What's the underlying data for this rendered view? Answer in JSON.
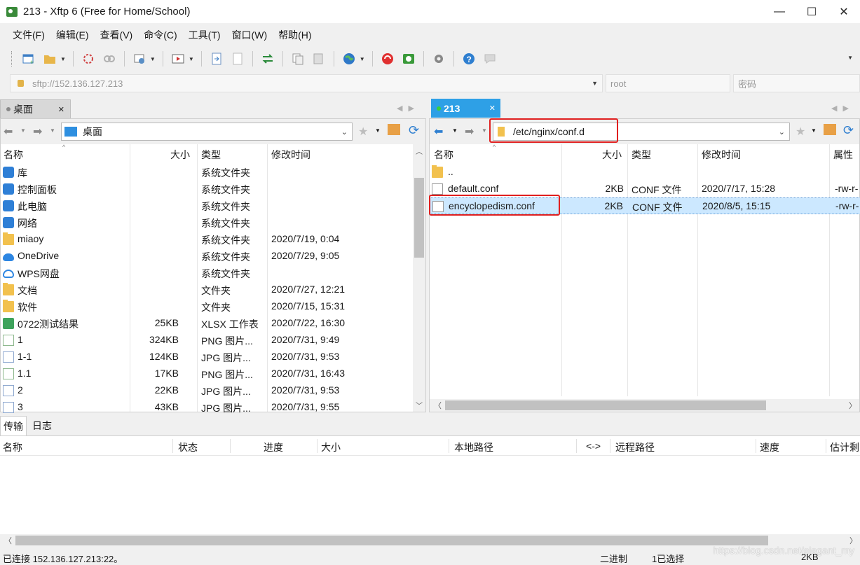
{
  "window": {
    "title": "213 - Xftp 6 (Free for Home/School)",
    "minimize": "—",
    "maximize": "☐",
    "close": "✕"
  },
  "menu": [
    "文件(F)",
    "编辑(E)",
    "查看(V)",
    "命令(C)",
    "工具(T)",
    "窗口(W)",
    "帮助(H)"
  ],
  "address": {
    "host_placeholder": "sftp://152.136.127.213",
    "user_placeholder": "root",
    "password_placeholder": "密码"
  },
  "local": {
    "tab": "桌面",
    "path": "桌面",
    "columns": [
      "名称",
      "大小",
      "类型",
      "修改时间"
    ],
    "rows": [
      {
        "name": "库",
        "size": "",
        "type": "系统文件夹",
        "modified": "",
        "icon": "library-icon"
      },
      {
        "name": "控制面板",
        "size": "",
        "type": "系统文件夹",
        "modified": "",
        "icon": "control-panel-icon"
      },
      {
        "name": "此电脑",
        "size": "",
        "type": "系统文件夹",
        "modified": "",
        "icon": "computer-icon"
      },
      {
        "name": "网络",
        "size": "",
        "type": "系统文件夹",
        "modified": "",
        "icon": "network-icon"
      },
      {
        "name": "miaoy",
        "size": "",
        "type": "系统文件夹",
        "modified": "2020/7/19, 0:04",
        "icon": "user-folder-icon"
      },
      {
        "name": "OneDrive",
        "size": "",
        "type": "系统文件夹",
        "modified": "2020/7/29, 9:05",
        "icon": "onedrive-icon"
      },
      {
        "name": "WPS网盘",
        "size": "",
        "type": "系统文件夹",
        "modified": "",
        "icon": "wps-cloud-icon"
      },
      {
        "name": "文档",
        "size": "",
        "type": "文件夹",
        "modified": "2020/7/27, 12:21",
        "icon": "folder-icon"
      },
      {
        "name": "软件",
        "size": "",
        "type": "文件夹",
        "modified": "2020/7/15, 15:31",
        "icon": "folder-icon"
      },
      {
        "name": "0722测试结果",
        "size": "25KB",
        "type": "XLSX 工作表",
        "modified": "2020/7/22, 16:30",
        "icon": "xlsx-icon"
      },
      {
        "name": "1",
        "size": "324KB",
        "type": "PNG 图片...",
        "modified": "2020/7/31, 9:49",
        "icon": "png-icon"
      },
      {
        "name": "1-1",
        "size": "124KB",
        "type": "JPG 图片...",
        "modified": "2020/7/31, 9:53",
        "icon": "jpg-icon"
      },
      {
        "name": "1.1",
        "size": "17KB",
        "type": "PNG 图片...",
        "modified": "2020/7/31, 16:43",
        "icon": "png-icon"
      },
      {
        "name": "2",
        "size": "22KB",
        "type": "JPG 图片...",
        "modified": "2020/7/31, 9:53",
        "icon": "jpg-icon"
      },
      {
        "name": "3",
        "size": "43KB",
        "type": "JPG 图片...",
        "modified": "2020/7/31, 9:55",
        "icon": "jpg-icon"
      }
    ]
  },
  "remote": {
    "tab": "213",
    "path": "/etc/nginx/conf.d",
    "columns": [
      "名称",
      "大小",
      "类型",
      "修改时间",
      "属性"
    ],
    "rows": [
      {
        "name": "..",
        "size": "",
        "type": "",
        "modified": "",
        "attr": "",
        "icon": "folder-icon"
      },
      {
        "name": "default.conf",
        "size": "2KB",
        "type": "CONF 文件",
        "modified": "2020/7/17, 15:28",
        "attr": "-rw-r-",
        "icon": "file-icon"
      },
      {
        "name": "encyclopedism.conf",
        "size": "2KB",
        "type": "CONF 文件",
        "modified": "2020/8/5, 15:15",
        "attr": "-rw-r-",
        "icon": "file-icon",
        "selected": true
      }
    ]
  },
  "bottom_tabs": [
    "传输",
    "日志"
  ],
  "transfer_columns": [
    "名称",
    "状态",
    "进度",
    "大小",
    "本地路径",
    "<->",
    "远程路径",
    "速度",
    "估计剩"
  ],
  "status": {
    "connection": "已连接 152.136.127.213:22。",
    "mode": "二进制",
    "selection": "1已选择",
    "size": "2KB"
  },
  "watermark": "https://blog.csdn.net/elegant_my",
  "colors": {
    "accent": "#2ea0e6",
    "selection": "#cce8ff",
    "highlight": "#e02020"
  }
}
